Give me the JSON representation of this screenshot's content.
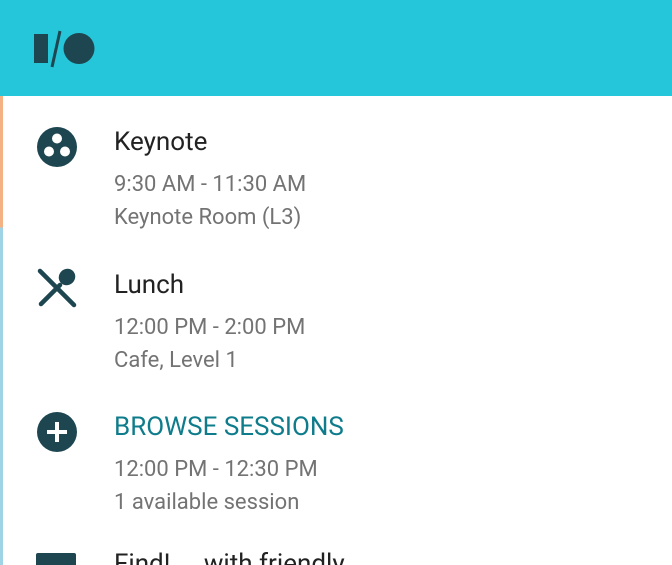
{
  "app": {
    "logo_icon": "google-io-logo"
  },
  "schedule": {
    "items": [
      {
        "title": "Keynote",
        "time": "9:30 AM - 11:30 AM",
        "location": "Keynote Room (L3)",
        "icon": "keynote-icon"
      },
      {
        "title": "Lunch",
        "time": "12:00 PM - 2:00 PM",
        "location": "Cafe, Level 1",
        "icon": "fork-knife-icon"
      },
      {
        "title": "BROWSE SESSIONS",
        "time": "12:00 PM - 12:30 PM",
        "location": "1 available session",
        "icon": "add-circle-icon"
      }
    ],
    "partial_item": {
      "title": "Find!  ...  with friendly",
      "icon": "folder-icon"
    }
  },
  "colors": {
    "toolbar": "#26c6da",
    "icon": "#1d4650",
    "accent_text": "#0e7c8b",
    "primary_text": "#222222",
    "secondary_text": "#737373"
  }
}
